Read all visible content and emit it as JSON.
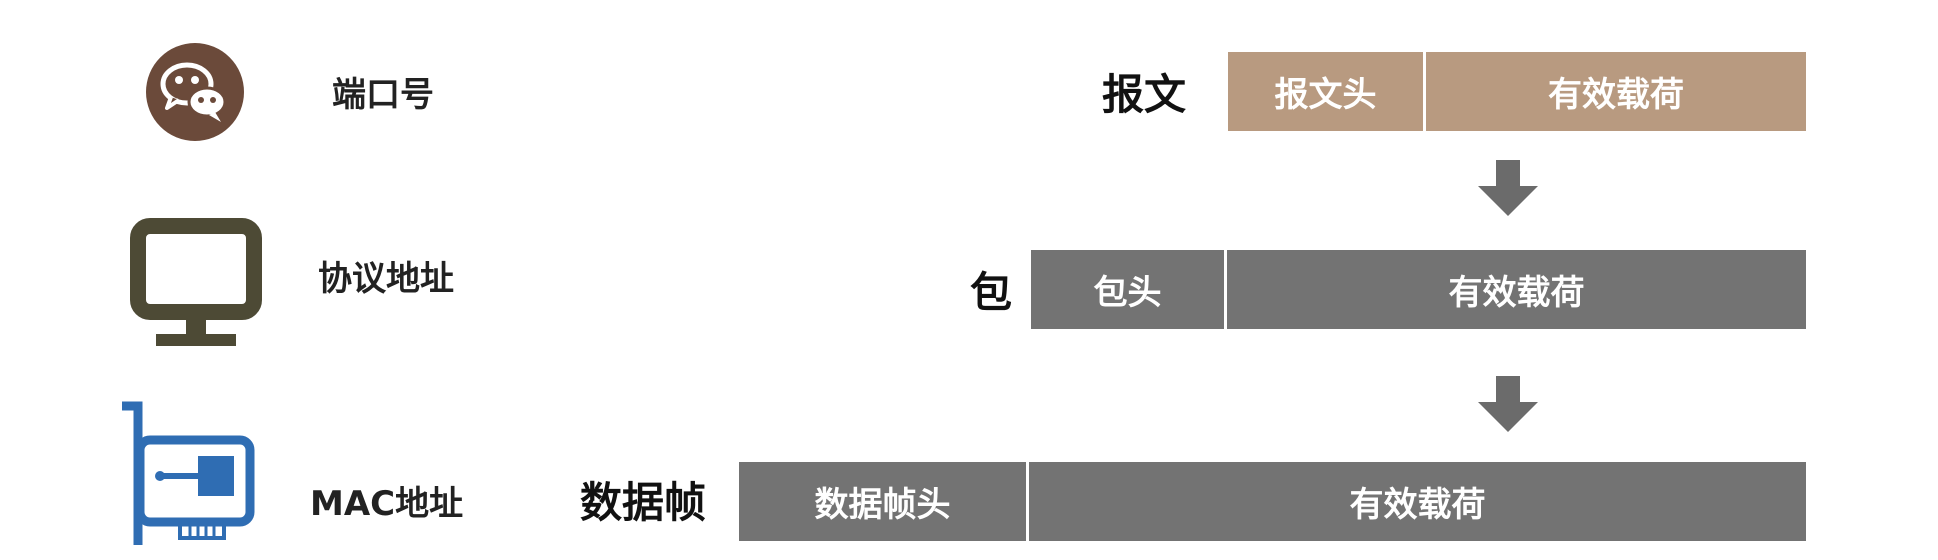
{
  "colors": {
    "message": "#b89a80",
    "packet": "#737373",
    "frame": "#737373",
    "wechat_icon": "#6b4a3a",
    "monitor_icon": "#4d4a35",
    "nic_icon": "#2f6db3",
    "arrow": "#6b6b6b"
  },
  "icons": {
    "port": "wechat-icon",
    "protocol": "monitor-icon",
    "mac": "network-card-icon",
    "arrow": "arrow-down-icon"
  },
  "rows": {
    "port": "端口号",
    "protocol": "协议地址",
    "mac": "MAC地址"
  },
  "message": {
    "label": "报文",
    "header": "报文头",
    "payload": "有效载荷"
  },
  "packet": {
    "label": "包",
    "header": "包头",
    "payload": "有效载荷"
  },
  "frame": {
    "label": "数据帧",
    "header": "数据帧头",
    "payload": "有效载荷"
  }
}
